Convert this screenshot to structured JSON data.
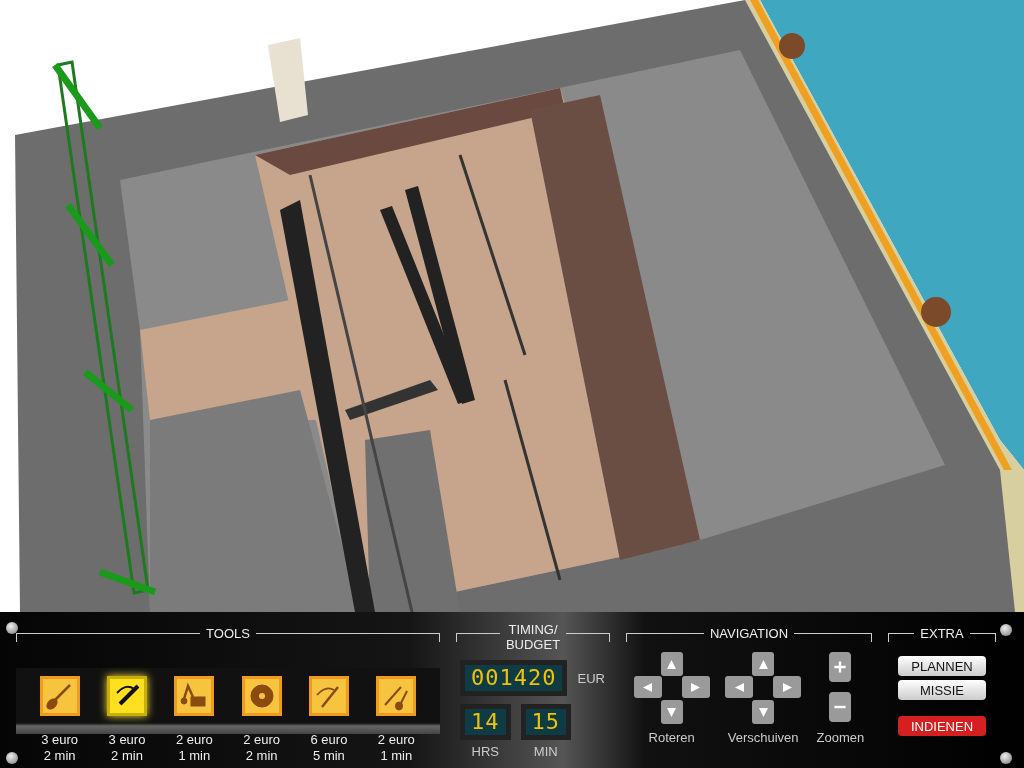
{
  "tools": {
    "title": "TOOLS",
    "items": [
      {
        "cost": "3 euro",
        "time": "2 min",
        "selected": false
      },
      {
        "cost": "3 euro",
        "time": "2 min",
        "selected": true
      },
      {
        "cost": "2 euro",
        "time": "1 min",
        "selected": false
      },
      {
        "cost": "2 euro",
        "time": "2 min",
        "selected": false
      },
      {
        "cost": "6 euro",
        "time": "5 min",
        "selected": false
      },
      {
        "cost": "2 euro",
        "time": "1 min",
        "selected": false
      }
    ]
  },
  "timing": {
    "title": "TIMING/\nBUDGET",
    "budget": "001420",
    "currency": "EUR",
    "hours": "14",
    "hours_label": "HRS",
    "minutes": "15",
    "minutes_label": "MIN"
  },
  "navigation": {
    "title": "NAVIGATION",
    "rotate_label": "Roteren",
    "pan_label": "Verschuiven",
    "zoom_label": "Zoomen"
  },
  "extra": {
    "title": "EXTRA",
    "buttons": [
      {
        "label": "PLANNEN",
        "kind": "normal"
      },
      {
        "label": "MISSIE",
        "kind": "normal"
      },
      {
        "label": "INDIENEN",
        "kind": "submit"
      }
    ]
  }
}
